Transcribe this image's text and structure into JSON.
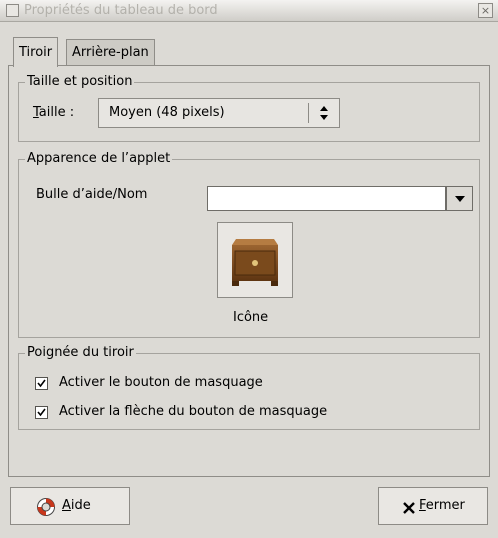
{
  "window": {
    "title": "Propriétés du tableau de bord",
    "close_glyph": "×"
  },
  "tabs": [
    {
      "label": "Tiroir",
      "active": true
    },
    {
      "label": "Arrière-plan",
      "active": false
    }
  ],
  "size_section": {
    "title": "Taille et position",
    "size_label_mnemonic": "T",
    "size_label_rest": "aille :",
    "size_value": "Moyen (48 pixels)"
  },
  "applet_section": {
    "title": "Apparence de l’applet",
    "tooltip_label": "Bulle d’aide/Nom",
    "tooltip_value": "",
    "icon_caption": "Icône",
    "icon_name": "drawer-icon"
  },
  "handle_section": {
    "title": "Poignée du tiroir",
    "options": [
      {
        "label": "Activer le bouton de masquage",
        "checked": true
      },
      {
        "label": "Activer la flèche du bouton de masquage",
        "checked": true
      }
    ]
  },
  "buttons": {
    "help_mnemonic": "A",
    "help_rest": "ide",
    "help_icon": "lifebuoy-icon",
    "close_mnemonic": "F",
    "close_rest": "ermer",
    "close_icon": "x-icon"
  },
  "colors": {
    "window_bg": "#dcdad5",
    "drawer_brown": "#7a4a1c",
    "help_red": "#c8371c"
  }
}
